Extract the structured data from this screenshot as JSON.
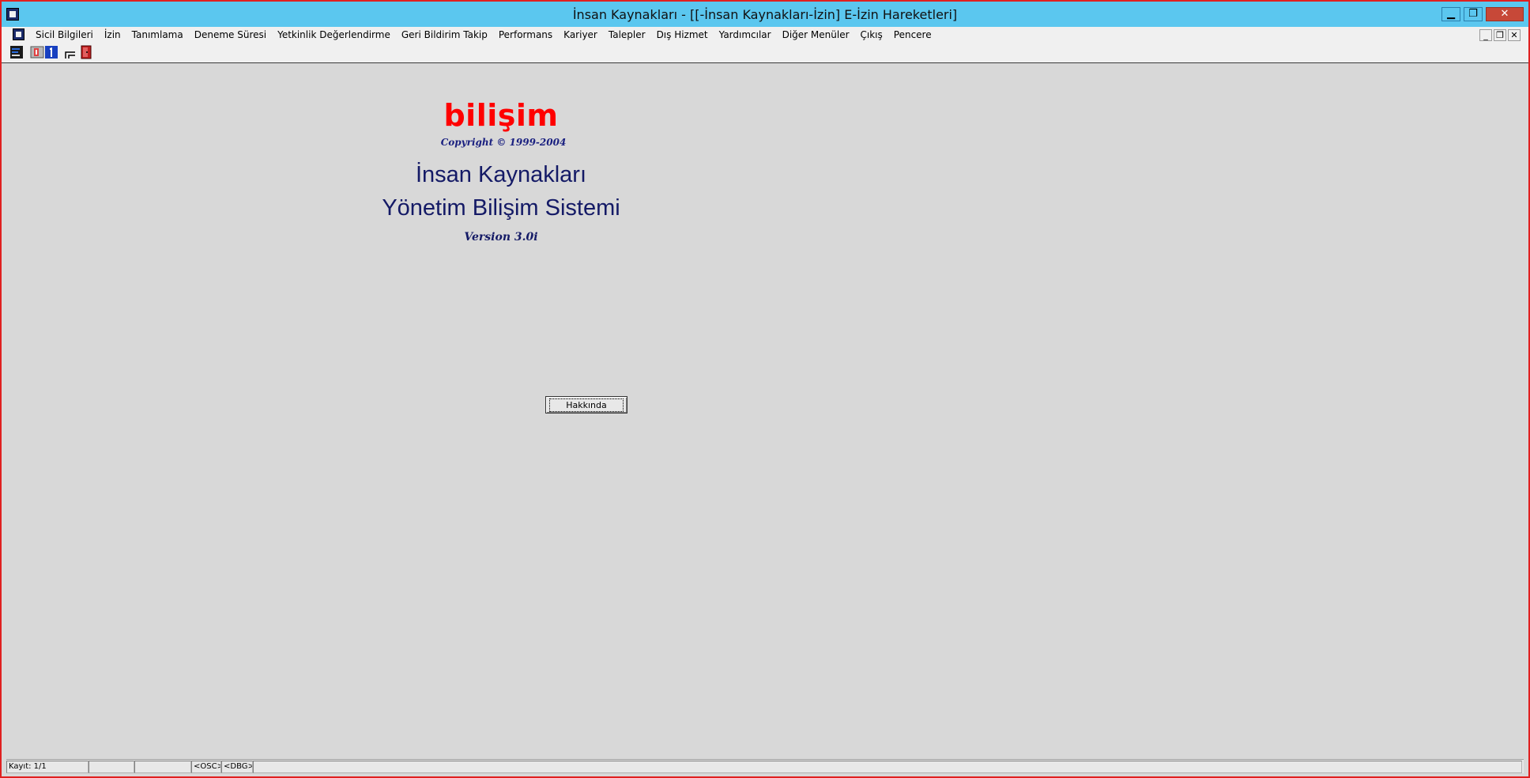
{
  "window": {
    "title": "İnsan Kaynakları - [[-İnsan Kaynakları-İzin] E-İzin Hareketleri]",
    "controls": {
      "minimize": "▁",
      "restore": "❐",
      "close": "✕"
    }
  },
  "menu": {
    "items": [
      "Sicil Bilgileri",
      "İzin",
      "Tanımlama",
      "Deneme Süresi",
      "Yetkinlik Değerlendirme",
      "Geri Bildirim Takip",
      "Performans",
      "Kariyer",
      "Talepler",
      "Dış Hizmet",
      "Yardımcılar",
      "Diğer Menüler",
      "Çıkış",
      "Pencere"
    ],
    "mdi_controls": {
      "minimize": "_",
      "restore": "❐",
      "close": "✕"
    }
  },
  "toolbar": {
    "icons": [
      "form-icon",
      "print-icon",
      "number-one-icon",
      "tree-icon",
      "exit-door-icon"
    ]
  },
  "splash": {
    "brand": "bilişim",
    "copyright": "Copyright © 1999-2004",
    "title_line1": "İnsan Kaynakları",
    "title_line2": "Yönetim Bilişim Sistemi",
    "version": "Version 3.0i",
    "about_button": "Hakkında"
  },
  "status": {
    "cells": [
      "Kayıt: 1/1",
      "",
      "",
      "<OSC>",
      "<DBG>",
      ""
    ]
  },
  "colors": {
    "titlebar": "#5bc7ef",
    "brand": "#ff0000",
    "title_text": "#141a66",
    "window_border": "#e02020"
  }
}
